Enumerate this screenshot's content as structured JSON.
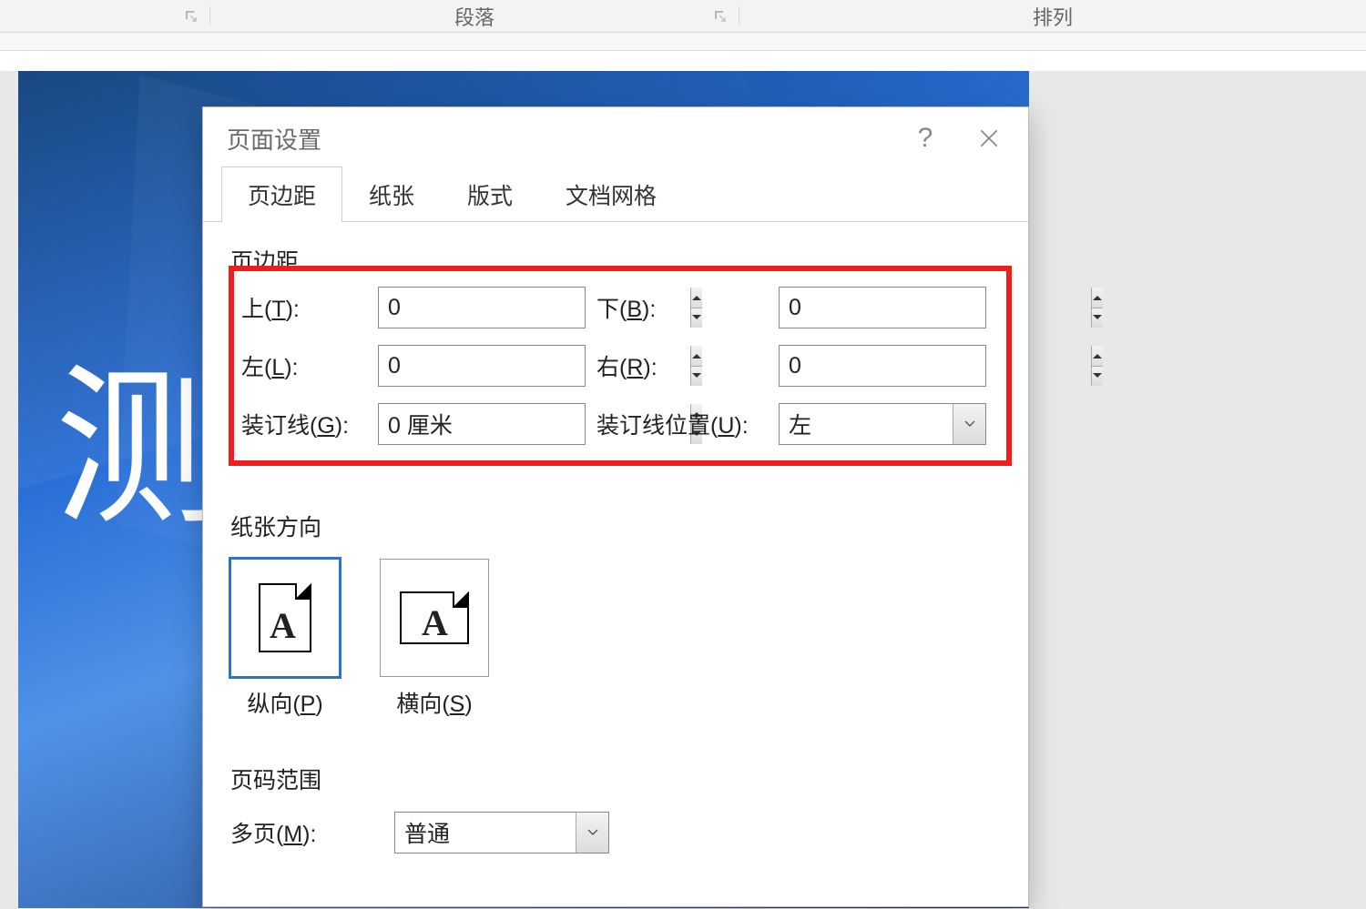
{
  "ribbon": {
    "group_paragraph": "段落",
    "group_arrange": "排列"
  },
  "background_text": "测",
  "dialog": {
    "title": "页面设置",
    "tabs": {
      "margins": "页边距",
      "paper": "纸张",
      "layout": "版式",
      "grid": "文档网格"
    },
    "section_margins": "页边距",
    "labels": {
      "top": {
        "prefix": "上(",
        "accel": "T",
        "suffix": "):"
      },
      "bottom": {
        "prefix": "下(",
        "accel": "B",
        "suffix": "):"
      },
      "left": {
        "prefix": "左(",
        "accel": "L",
        "suffix": "):"
      },
      "right": {
        "prefix": "右(",
        "accel": "R",
        "suffix": "):"
      },
      "gutter": {
        "prefix": "装订线(",
        "accel": "G",
        "suffix": "):"
      },
      "gutter_pos": {
        "prefix": "装订线位置(",
        "accel": "U",
        "suffix": "):"
      }
    },
    "values": {
      "top": "0",
      "bottom": "0",
      "left": "0",
      "right": "0",
      "gutter": "0 厘米",
      "gutter_pos": "左"
    },
    "section_orientation": "纸张方向",
    "orient": {
      "portrait": {
        "prefix": "纵向(",
        "accel": "P",
        "suffix": ")"
      },
      "landscape": {
        "prefix": "横向(",
        "accel": "S",
        "suffix": ")"
      }
    },
    "section_range": "页码范围",
    "range": {
      "multi": {
        "prefix": "多页(",
        "accel": "M",
        "suffix": "):"
      },
      "multi_value": "普通"
    }
  }
}
